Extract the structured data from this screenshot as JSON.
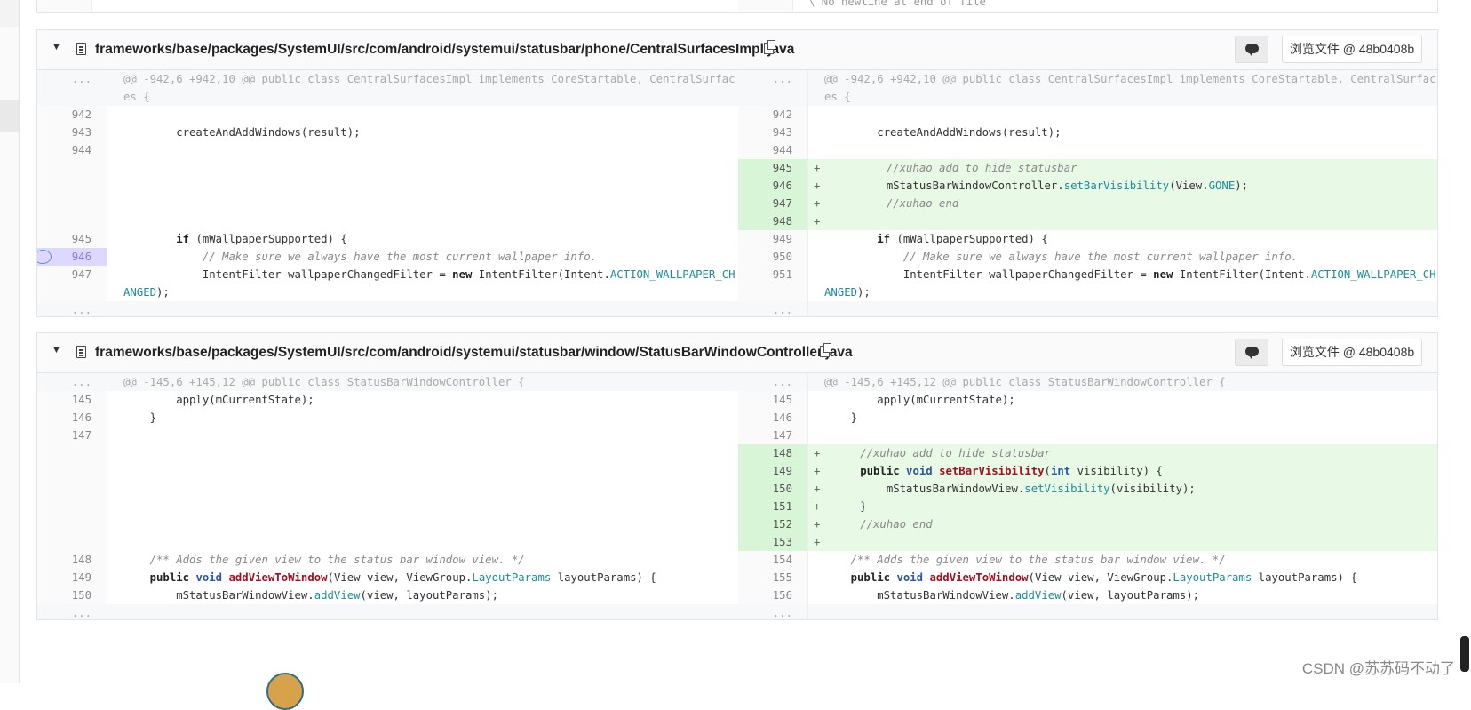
{
  "prev_file": {
    "no_newline_text": "\\ No newline at end of file"
  },
  "files": [
    {
      "path": "frameworks/base/packages/SystemUI/src/com/android/systemui/statusbar/phone/CentralSurfacesImpl.java",
      "view_button": "浏览文件 @ 48b0408b",
      "hunk_header": "@@ -942,6 +942,10 @@ public class CentralSurfacesImpl implements CoreStartable, CentralSurfaces {"
    },
    {
      "path": "frameworks/base/packages/SystemUI/src/com/android/systemui/statusbar/window/StatusBarWindowController.java",
      "view_button": "浏览文件 @ 48b0408b",
      "hunk_header": "@@ -145,6 +145,12 @@ public class StatusBarWindowController {"
    }
  ],
  "expand_label": "...",
  "watermark": "CSDN @苏苏码不动了"
}
